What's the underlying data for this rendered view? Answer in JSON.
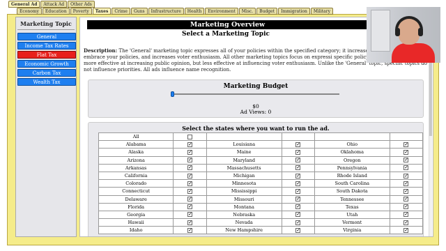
{
  "tabs_top": [
    {
      "label": "General Ad",
      "active": true
    },
    {
      "label": "Attack Ad",
      "active": false
    },
    {
      "label": "Other Ads",
      "active": false
    }
  ],
  "tabs_sub": [
    {
      "label": "Economy",
      "active": false
    },
    {
      "label": "Education",
      "active": false
    },
    {
      "label": "Poverty",
      "active": false
    },
    {
      "label": "Taxes",
      "active": true
    },
    {
      "label": "Crime",
      "active": false
    },
    {
      "label": "Guns",
      "active": false
    },
    {
      "label": "Infrastructure",
      "active": false
    },
    {
      "label": "Health",
      "active": false
    },
    {
      "label": "Environment",
      "active": false
    },
    {
      "label": "Misc.",
      "active": false
    },
    {
      "label": "Budget",
      "active": false
    },
    {
      "label": "Immigration",
      "active": false
    },
    {
      "label": "Military",
      "active": false
    }
  ],
  "sidebar": {
    "title": "Marketing Topic",
    "items": [
      {
        "label": "General",
        "selected": false
      },
      {
        "label": "Income Tax Rates",
        "selected": false
      },
      {
        "label": "Flat Tax",
        "selected": true
      },
      {
        "label": "Economic Growth",
        "selected": false
      },
      {
        "label": "Carbon Tax",
        "selected": false
      },
      {
        "label": "Wealth Tax",
        "selected": false
      }
    ]
  },
  "main": {
    "title": "Marketing Overview",
    "subtitle": "Select a Marketing Topic",
    "description_label": "Description:",
    "description_text": "The 'General' marketing topic expresses all of your policies within the specified category; it increases sways voters to embrace your policies, and increases voter enthusiasm. All other marketing topics focus on expressi specific policy. The specific topics are more effective at increasing public opinion, but less effective at influencing voter enthusiasm. Unlike the 'General' topic, specific topics do not influence priorities. All ads influence name recognition.",
    "budget_title": "Marketing Budget",
    "budget_value": "$0",
    "ad_views": "Ad Views: 0",
    "budget_slider_fraction": 0,
    "states_title": "Select the states where you want to run the ad.",
    "all_label": "All",
    "all_checked": false
  },
  "states_columns": [
    [
      {
        "name": "Alabama",
        "checked": true
      },
      {
        "name": "Alaska",
        "checked": true
      },
      {
        "name": "Arizona",
        "checked": true
      },
      {
        "name": "Arkansas",
        "checked": true
      },
      {
        "name": "California",
        "checked": true
      },
      {
        "name": "Colorado",
        "checked": true
      },
      {
        "name": "Connecticut",
        "checked": true
      },
      {
        "name": "Delaware",
        "checked": true
      },
      {
        "name": "Florida",
        "checked": true
      },
      {
        "name": "Georgia",
        "checked": true
      },
      {
        "name": "Hawaii",
        "checked": true
      },
      {
        "name": "Idaho",
        "checked": true
      }
    ],
    [
      {
        "name": "Louisiana",
        "checked": true
      },
      {
        "name": "Maine",
        "checked": true
      },
      {
        "name": "Maryland",
        "checked": true
      },
      {
        "name": "Massachusetts",
        "checked": true
      },
      {
        "name": "Michigan",
        "checked": true
      },
      {
        "name": "Minnesota",
        "checked": true
      },
      {
        "name": "Mississippi",
        "checked": true
      },
      {
        "name": "Missouri",
        "checked": true
      },
      {
        "name": "Montana",
        "checked": true
      },
      {
        "name": "Nebraska",
        "checked": true
      },
      {
        "name": "Nevada",
        "checked": true
      },
      {
        "name": "New Hampshire",
        "checked": true
      }
    ],
    [
      {
        "name": "Ohio",
        "checked": true
      },
      {
        "name": "Oklahoma",
        "checked": true
      },
      {
        "name": "Oregon",
        "checked": true
      },
      {
        "name": "Pennsylvania",
        "checked": true
      },
      {
        "name": "Rhode Island",
        "checked": true
      },
      {
        "name": "South Carolina",
        "checked": true
      },
      {
        "name": "South Dakota",
        "checked": true
      },
      {
        "name": "Tennessee",
        "checked": true
      },
      {
        "name": "Texas",
        "checked": true
      },
      {
        "name": "Utah",
        "checked": true
      },
      {
        "name": "Vermont",
        "checked": true
      },
      {
        "name": "Virginia",
        "checked": true
      }
    ]
  ],
  "colors": {
    "frame": "#f5ec8a",
    "button_blue": "#1e7ff0",
    "button_selected_red": "#e8201c"
  }
}
